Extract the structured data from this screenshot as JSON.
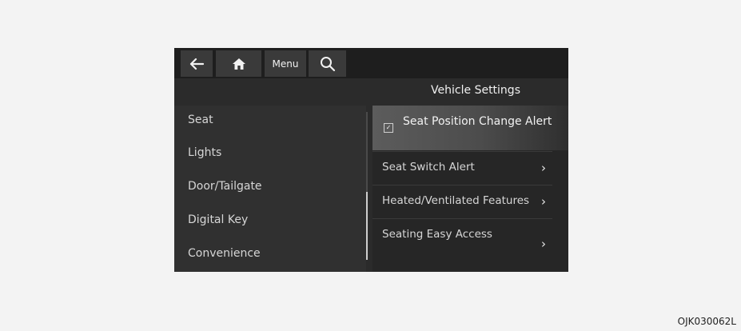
{
  "toolbar": {
    "back_icon": "back-arrow-icon",
    "home_icon": "home-icon",
    "menu_label": "Menu",
    "search_icon": "search-icon"
  },
  "page_title": "Vehicle Settings",
  "sidebar": {
    "items": [
      {
        "label": "Seat"
      },
      {
        "label": "Lights"
      },
      {
        "label": "Door/Tailgate"
      },
      {
        "label": "Digital Key"
      },
      {
        "label": "Convenience"
      }
    ]
  },
  "settings": {
    "selected": {
      "label": "Seat Position Change Alert",
      "checked": true
    },
    "items": [
      {
        "label": "Seat Switch Alert",
        "chevron": "›"
      },
      {
        "label": "Heated/Ventilated Features",
        "chevron": "›"
      },
      {
        "label": "Seating Easy Access",
        "chevron": "›"
      }
    ]
  },
  "footer_code": "OJK030062L"
}
